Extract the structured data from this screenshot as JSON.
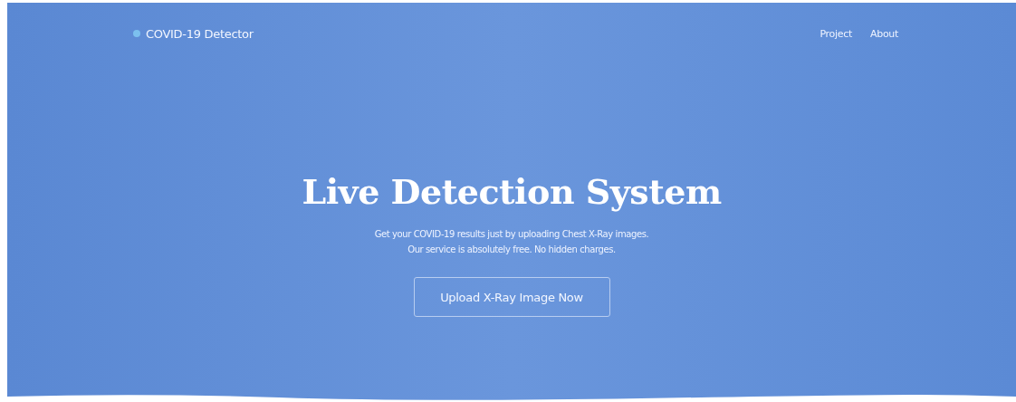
{
  "navbar": {
    "brand": "COVID-19 Detector",
    "links": [
      {
        "label": "Project"
      },
      {
        "label": "About"
      }
    ]
  },
  "hero": {
    "title": "Live Detection System",
    "lines": [
      "Get your COVID-19 results just by uploading Chest X-Ray images.",
      "Our service is absolutely free. No hidden charges."
    ],
    "button": "Upload X-Ray Image Now"
  }
}
